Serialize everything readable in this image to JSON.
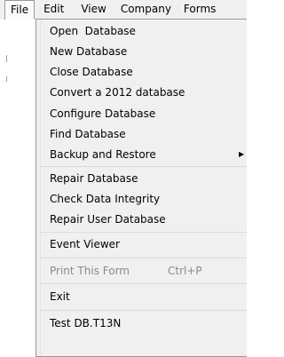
{
  "menubar": {
    "items": [
      {
        "label": "File"
      },
      {
        "label": "Edit"
      },
      {
        "label": "View"
      },
      {
        "label": "Company"
      },
      {
        "label": "Forms"
      }
    ]
  },
  "file_menu": {
    "group1": [
      {
        "label": "Open  Database"
      },
      {
        "label": "New Database"
      },
      {
        "label": "Close Database"
      },
      {
        "label": "Convert a 2012 database"
      },
      {
        "label": "Configure Database"
      },
      {
        "label": "Find Database"
      },
      {
        "label": "Backup and Restore",
        "submenu_icon": "submenu-arrow-icon",
        "submenu_glyph": "▶"
      }
    ],
    "group2": [
      {
        "label": "Repair Database"
      },
      {
        "label": "Check Data Integrity"
      },
      {
        "label": "Repair User Database"
      }
    ],
    "group3": [
      {
        "label": "Event Viewer"
      }
    ],
    "group4": [
      {
        "label": "Print This Form",
        "shortcut": "Ctrl+P",
        "disabled": true
      }
    ],
    "group5": [
      {
        "label": "Exit"
      }
    ],
    "group6": [
      {
        "label": "Test DB.T13N"
      }
    ]
  },
  "colors": {
    "menubar_bg": "#f0f0f0",
    "menu_bg": "#f0f0f0",
    "disabled_text": "#8a8a8a",
    "border": "#979797"
  }
}
